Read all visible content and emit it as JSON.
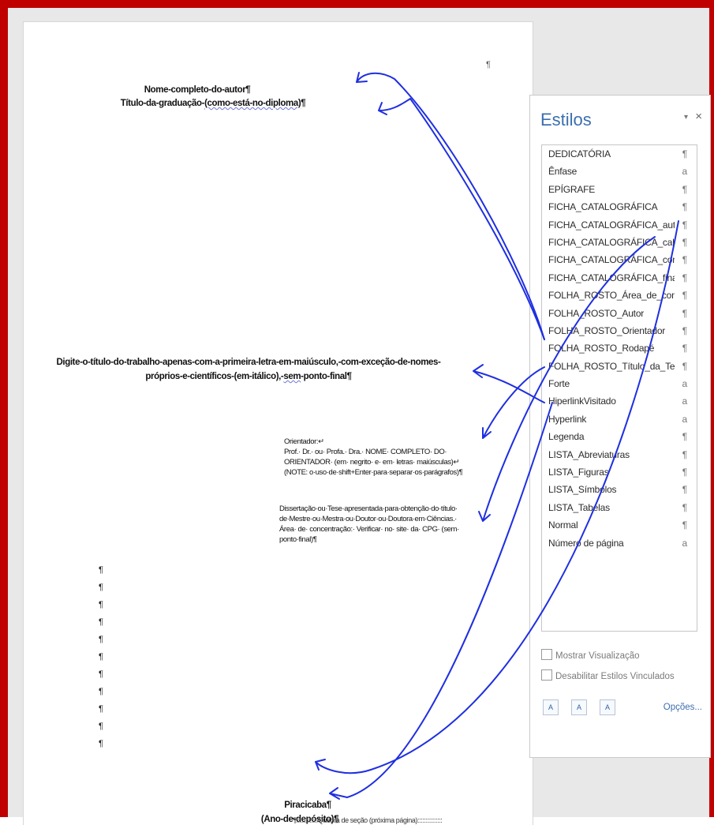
{
  "document": {
    "top_mark": "¶",
    "author_line": "Nome-completo-do-autor¶",
    "degree_line_a": "Título-da-graduação-",
    "degree_line_b": "(como-está-no-diploma)",
    "degree_line_c": "¶",
    "title_line1": "Digite-o-título-do-trabalho-apenas-com-a-primeira-letra-em-maiúsculo,-com-exceção-de-nomes-",
    "title_line2a": "próprios-e-científicos-(em-itálico),-",
    "title_line2b": "sem",
    "title_line2c": "-ponto-final¶",
    "advisor": [
      "Orientador:↵",
      "Prof.· Dr.· ou· Profa.· Dra.· NOME· COMPLETO· DO·",
      "ORIENTADOR· (em· negrito· e· em· letras· maiúsculas)↵",
      "(NOTE: o·uso·de·shift+Enter·para·separar·os·parágrafos)¶"
    ],
    "dissertation": [
      "Dissertação·ou·Tese·apresentada·para·obtenção·do·título·",
      "de·Mestre·ou·Mestra·ou·Doutor·ou·Doutora·em·Ciências.·",
      "Área· de· concentração:· Verificar· no· site· da· CPG· (sem·",
      "ponto·final)¶"
    ],
    "pilcrows": [
      "¶",
      "¶",
      "¶",
      "¶",
      "¶",
      "¶",
      "¶",
      "¶",
      "¶",
      "¶",
      "¶"
    ],
    "city": "Piracicaba¶",
    "year": "(Ano-de-depósito)¶",
    "section_break": "¶:::::::::::::Quebra de seção (próxima página):::::::::::::::"
  },
  "styles_panel": {
    "title": "Estilos",
    "dropdown_glyph": "▾",
    "close_glyph": "×",
    "items": [
      {
        "name": "DEDICATÓRIA",
        "mark": "¶"
      },
      {
        "name": "Ênfase",
        "mark": "a"
      },
      {
        "name": "EPÍGRAFE",
        "mark": "¶"
      },
      {
        "name": "FICHA_CATALOGRÁFICA",
        "mark": "¶"
      },
      {
        "name": "FICHA_CATALOGRÁFICA_auti",
        "mark": "¶"
      },
      {
        "name": "FICHA_CATALOGRÁFICA_cab",
        "mark": "¶"
      },
      {
        "name": "FICHA_CATALOGRÁFICA_corr",
        "mark": "¶"
      },
      {
        "name": "FICHA_CATALOGRÁFICA_fina",
        "mark": "¶"
      },
      {
        "name": "FOLHA_ROSTO_Área_de_con",
        "mark": "¶"
      },
      {
        "name": "FOLHA_ROSTO_Autor",
        "mark": "¶"
      },
      {
        "name": "FOLHA_ROSTO_Orientador",
        "mark": "¶"
      },
      {
        "name": "FOLHA_ROSTO_Rodapé",
        "mark": "¶"
      },
      {
        "name": "FOLHA_ROSTO_Título_da_Te:",
        "mark": "¶"
      },
      {
        "name": "Forte",
        "mark": "a"
      },
      {
        "name": "HiperlinkVisitado",
        "mark": "a"
      },
      {
        "name": "Hyperlink",
        "mark": "a"
      },
      {
        "name": "Legenda",
        "mark": "¶"
      },
      {
        "name": "LISTA_Abreviaturas",
        "mark": "¶"
      },
      {
        "name": "LISTA_Figuras",
        "mark": "¶"
      },
      {
        "name": "LISTA_Símbolos",
        "mark": "¶"
      },
      {
        "name": "LISTA_Tabelas",
        "mark": "¶"
      },
      {
        "name": "Normal",
        "mark": "¶"
      },
      {
        "name": "Número de página",
        "mark": "a"
      }
    ],
    "show_preview_label": "Mostrar Visualização",
    "disable_linked_label": "Desabilitar Estilos Vinculados",
    "options_label": "Opções...",
    "buttons": [
      "A",
      "A",
      "A"
    ]
  },
  "colors": {
    "frame": "#c00000",
    "ink": "#1f2fe0",
    "panel_title": "#3b6fae"
  }
}
